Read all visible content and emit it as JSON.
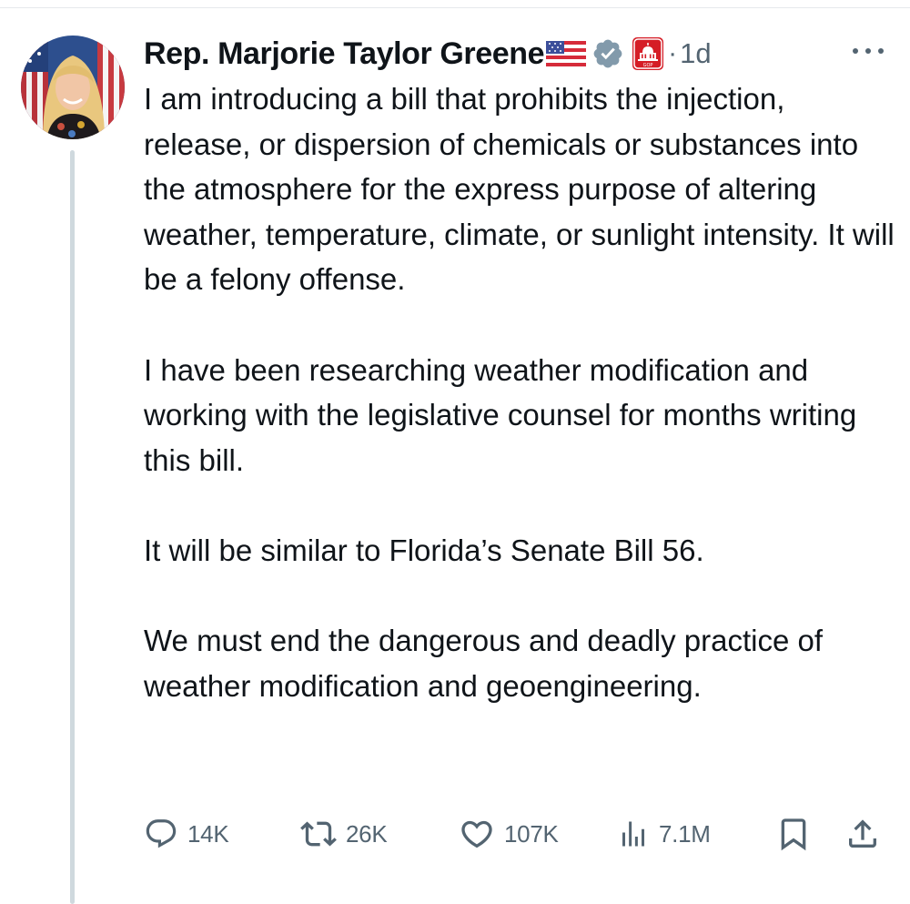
{
  "author": {
    "display_name": "Rep. Marjorie Taylor Greene",
    "avatar_icon": "avatar-photo",
    "flag_icon": "us-flag-emoji",
    "verified_icon": "gray-verified-badge-icon",
    "affiliate_icon": "gop-capitol-badge-icon"
  },
  "meta": {
    "separator": "·",
    "time": "1d"
  },
  "tweet": {
    "paragraphs": [
      "I am introducing a bill that prohibits the injection, release, or dispersion of chemicals or substances into the atmosphere for the express purpose of altering weather, temperature, climate, or sunlight intensity. It will be a felony offense.",
      "I have been researching weather modification and working with the legislative counsel for months writing this bill.",
      "It will be similar to Florida’s Senate Bill 56.",
      "We must end the dangerous and deadly practice of weather modification and geoengineering."
    ]
  },
  "actions": {
    "reply_count": "14K",
    "repost_count": "26K",
    "like_count": "107K",
    "views_count": "7.1M"
  },
  "colors": {
    "text": "#0f1419",
    "secondary": "#536471",
    "thread_line": "#cfd9de",
    "verified_gray": "#829aab",
    "affiliate_red": "#d51d26"
  }
}
